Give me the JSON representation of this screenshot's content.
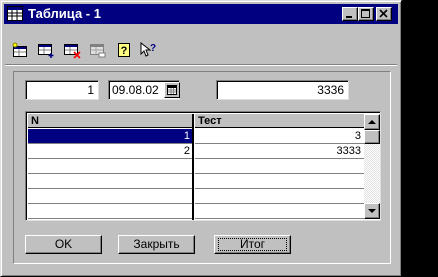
{
  "window": {
    "title": "Таблица - 1",
    "title_bar_color": "#000080",
    "face_color": "#c0c0c0",
    "icon": "table-window-icon"
  },
  "title_buttons": [
    {
      "name": "minimize-button",
      "icon": "minimize-icon"
    },
    {
      "name": "maximize-button",
      "icon": "maximize-icon"
    },
    {
      "name": "close-button",
      "icon": "close-icon"
    }
  ],
  "toolbar": {
    "items": [
      {
        "name": "new-record-button",
        "icon": "new-table-icon"
      },
      {
        "name": "add-row-button",
        "icon": "grid-add-icon"
      },
      {
        "name": "delete-row-button",
        "icon": "grid-delete-icon"
      },
      {
        "name": "edit-row-button",
        "icon": "grid-edit-icon"
      },
      {
        "name": "help-button",
        "icon": "help-icon"
      },
      {
        "name": "context-help-button",
        "icon": "pointer-help-icon"
      }
    ]
  },
  "header_fields": {
    "number_value": "1",
    "date_value": "09.08.02",
    "total_value": "3336",
    "calendar_icon": "calendar-icon"
  },
  "grid": {
    "columns": [
      "N",
      "Тест"
    ],
    "rows": [
      {
        "n": "1",
        "test": "3",
        "selected": true
      },
      {
        "n": "2",
        "test": "3333",
        "selected": false
      },
      {
        "n": "",
        "test": "",
        "selected": false
      },
      {
        "n": "",
        "test": "",
        "selected": false
      },
      {
        "n": "",
        "test": "",
        "selected": false
      },
      {
        "n": "",
        "test": "",
        "selected": false
      }
    ],
    "selection_color": "#000080"
  },
  "buttons": {
    "ok_label": "OK",
    "close_label": "Закрыть",
    "total_label": "Итог"
  }
}
